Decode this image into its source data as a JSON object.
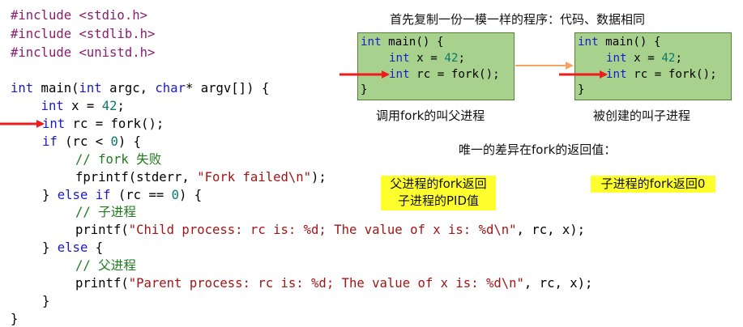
{
  "code": {
    "include_1": "#include <stdio.h>",
    "include_2": "#include <stdlib.h>",
    "include_3": "#include <unistd.h>",
    "main_kw_int": "int",
    "main_sig_1": " main(",
    "main_kw_int2": "int",
    "main_sig_2": " argc, ",
    "main_kw_char": "char",
    "main_sig_3": "* argv[]) {",
    "decl_x_indent": "    ",
    "decl_x_kw": "int",
    "decl_x_text": " x = ",
    "decl_x_num": "42",
    "decl_x_end": ";",
    "decl_rc_kw": "int",
    "decl_rc_text": " rc = fork();",
    "if_kw": "if",
    "if_text_1": " (rc < ",
    "if_num": "0",
    "if_text_2": ") {",
    "comment_fail": "// fork 失败",
    "fprintf_text": "fprintf(stderr, ",
    "fprintf_str": "\"Fork failed\\n\"",
    "fprintf_end": ");",
    "elseif_1": "} ",
    "elseif_kw": "else if",
    "elseif_2": " (rc == ",
    "elseif_num": "0",
    "elseif_3": ") {",
    "comment_child": "// 子进程",
    "printf_child_fn": "printf(",
    "printf_child_str": "\"Child process: rc is: %d; The value of x is: %d\\n\"",
    "printf_child_end": ", rc, x);",
    "else_1": "} ",
    "else_kw": "else",
    "else_2": " {",
    "comment_parent": "// 父进程",
    "printf_parent_fn": "printf(",
    "printf_parent_str": "\"Parent process: rc is: %d; The value of x is: %d\\n\"",
    "printf_parent_end": ", rc, x);",
    "close_inner": "}",
    "close_outer": "}"
  },
  "diagram": {
    "title": "首先复制一份一模一样的程序：代码、数据相同",
    "parent_caption": "调用fork的叫父进程",
    "child_caption": "被创建的叫子进程",
    "difference_note": "唯一的差异在fork的返回值：",
    "parent_return_line_1": "父进程的fork返回",
    "parent_return_line_2": "子进程的PID值",
    "child_return": "子进程的fork返回0",
    "box_code": {
      "line1_kw": "int",
      "line1_rest": " main() {",
      "line2_kw": "int",
      "line2_text": " x = ",
      "line2_num": "42",
      "line2_end": ";",
      "line3_kw": "int",
      "line3_text": " rc = fork();",
      "line4": "}"
    }
  },
  "colors": {
    "arrow_red": "#ee1c1c",
    "arrow_orange": "#f4a460",
    "box_fill": "#a9d18e",
    "box_border": "#548235",
    "highlight": "#ffff2e",
    "keyword": "#1a1acb",
    "preprocessor": "#8a1c6e",
    "number": "#0a7a6a",
    "string": "#a31515",
    "comment": "#1f7a1f"
  }
}
